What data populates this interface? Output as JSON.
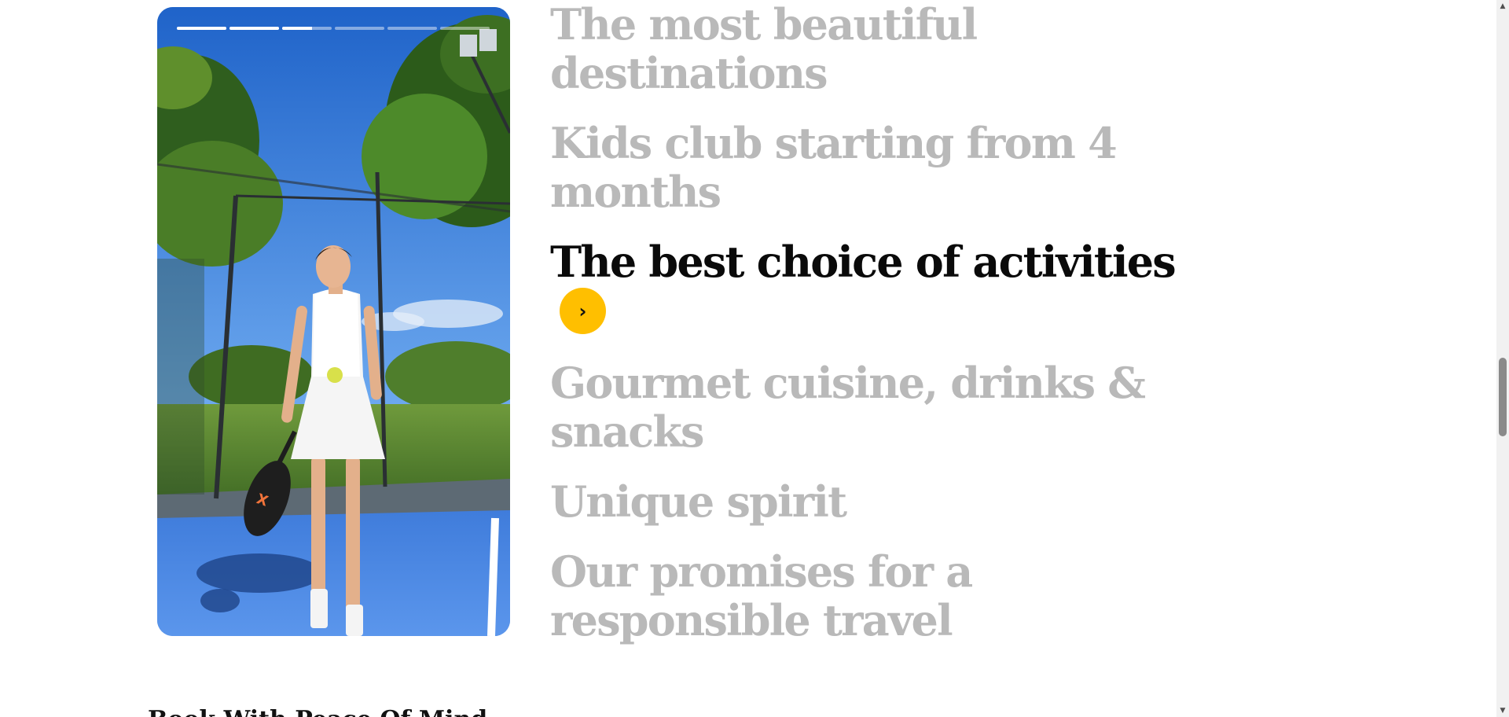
{
  "story": {
    "image_alt": "Woman holding a padel racket and ball on a blue padel court",
    "segments": [
      {
        "progress": 1
      },
      {
        "progress": 1
      },
      {
        "progress": 0.6
      },
      {
        "progress": 0
      },
      {
        "progress": 0
      },
      {
        "progress": 0
      }
    ]
  },
  "features": [
    {
      "label": "The most beautiful destinations",
      "active": false
    },
    {
      "label": "Kids club starting from 4 months",
      "active": false
    },
    {
      "label": "The best choice of activities",
      "active": true,
      "button_icon": "chevron-right-icon",
      "button_glyph": "›"
    },
    {
      "label": "Gourmet cuisine, drinks & snacks",
      "active": false
    },
    {
      "label": "Unique spirit",
      "active": false
    },
    {
      "label": "Our promises for a responsible travel",
      "active": false
    }
  ],
  "next_section": {
    "heading": "Book With Peace Of Mind"
  },
  "scrollbar": {
    "up_glyph": "▲",
    "down_glyph": "▼"
  },
  "colors": {
    "accent": "#ffbf00",
    "inactive_text": "#b9b9b9",
    "active_text": "#0a0a0a"
  }
}
